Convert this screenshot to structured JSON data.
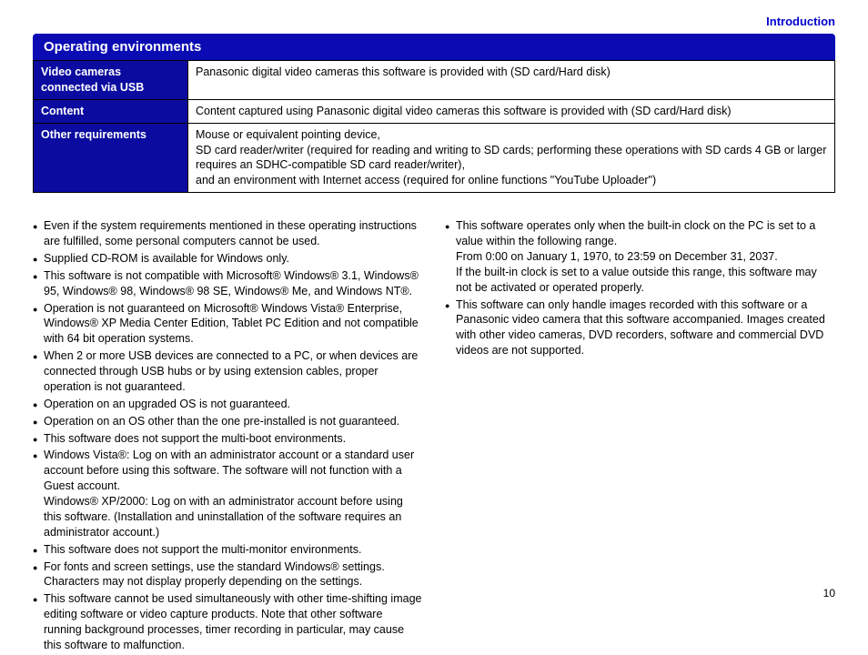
{
  "header": {
    "link": "Introduction",
    "section_title": "Operating environments"
  },
  "table": {
    "rows": [
      {
        "label": "Video cameras connected via USB",
        "value": "Panasonic digital video cameras this software is provided with (SD card/Hard disk)"
      },
      {
        "label": "Content",
        "value": "Content captured using Panasonic digital video cameras this software is provided with (SD card/Hard disk)"
      },
      {
        "label": "Other requirements",
        "value": "Mouse or equivalent pointing device,\nSD card reader/writer (required for reading and writing to SD cards; performing these operations with SD cards 4 GB or larger requires an SDHC-compatible SD card reader/writer),\nand an environment with Internet access (required for online functions \"YouTube Uploader\")"
      }
    ]
  },
  "notes": {
    "left": [
      "Even if the system requirements mentioned in these operating instructions are fulfilled, some personal computers cannot be used.",
      "Supplied CD-ROM is available for Windows only.",
      "This software is not compatible with Microsoft® Windows® 3.1, Windows® 95, Windows® 98, Windows® 98 SE, Windows® Me, and Windows NT®.",
      "Operation is not guaranteed on Microsoft® Windows Vista® Enterprise, Windows® XP Media Center Edition, Tablet PC Edition and not compatible with 64 bit operation systems.",
      "When 2 or more USB devices are connected to a PC, or when devices are connected through USB hubs or by using extension cables, proper operation is not guaranteed.",
      "Operation on an upgraded OS is not guaranteed.",
      "Operation on an OS other than the one pre-installed is not guaranteed.",
      "This software does not support the multi-boot environments.",
      "Windows Vista®: Log on with an administrator account or a standard user account before using this software. The software will not function with a Guest account.\nWindows® XP/2000: Log on with an administrator account before using this software. (Installation and uninstallation of the software requires an administrator account.)",
      "This software does not support the multi-monitor environments.",
      "For fonts and screen settings, use the standard Windows® settings. Characters may not display properly depending on the settings.",
      "This software cannot be used simultaneously with other time-shifting image editing software or video capture products. Note that other software running background processes, timer recording in particular, may cause this software to malfunction."
    ],
    "right": [
      "This software operates only when the built-in clock on the PC is set to a value within the following range.\nFrom 0:00 on January 1, 1970, to 23:59 on December 31, 2037.\nIf the built-in clock is set to a value outside this range, this software may not be activated or operated properly.",
      "This software can only handle images recorded with this software or a Panasonic video camera that this software accompanied. Images created with other video cameras, DVD recorders, software and commercial DVD videos are not supported."
    ]
  },
  "page_number": "10"
}
